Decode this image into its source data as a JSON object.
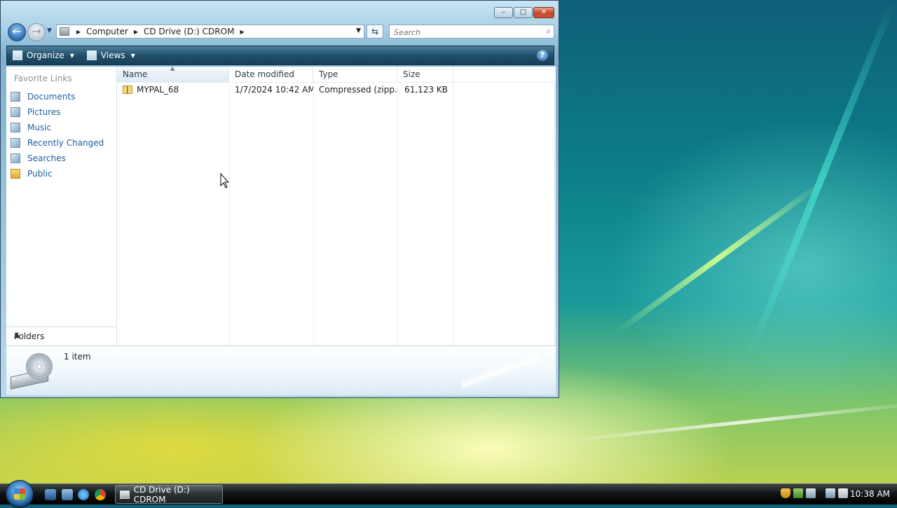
{
  "window": {
    "title_buttons": {
      "minimize": "–",
      "maximize": "□",
      "close": "✕"
    },
    "address": {
      "crumbs": [
        "Computer",
        "CD Drive (D:) CDROM"
      ]
    },
    "search": {
      "placeholder": "Search"
    },
    "toolbar": {
      "organize": "Organize",
      "views": "Views",
      "help": "?"
    },
    "sidebar": {
      "favorites_title": "Favorite Links",
      "items": [
        {
          "label": "Documents",
          "icon": "documents-icon"
        },
        {
          "label": "Pictures",
          "icon": "pictures-icon"
        },
        {
          "label": "Music",
          "icon": "music-icon"
        },
        {
          "label": "Recently Changed",
          "icon": "recently-changed-icon"
        },
        {
          "label": "Searches",
          "icon": "searches-icon"
        },
        {
          "label": "Public",
          "icon": "folder-icon"
        }
      ],
      "folders_label": "Folders"
    },
    "columns": [
      "Name",
      "Date modified",
      "Type",
      "Size"
    ],
    "files": [
      {
        "name": "MYPAL_68",
        "date": "1/7/2024 10:42 AM",
        "type": "Compressed (zipp...",
        "size": "61,123 KB"
      }
    ],
    "details": {
      "count": "1 item"
    }
  },
  "taskbar": {
    "active_task": "CD Drive (D:) CDROM",
    "clock": "10:38 AM"
  },
  "colors": {
    "link": "#1f5f9f",
    "toolbar": "#20506c"
  }
}
